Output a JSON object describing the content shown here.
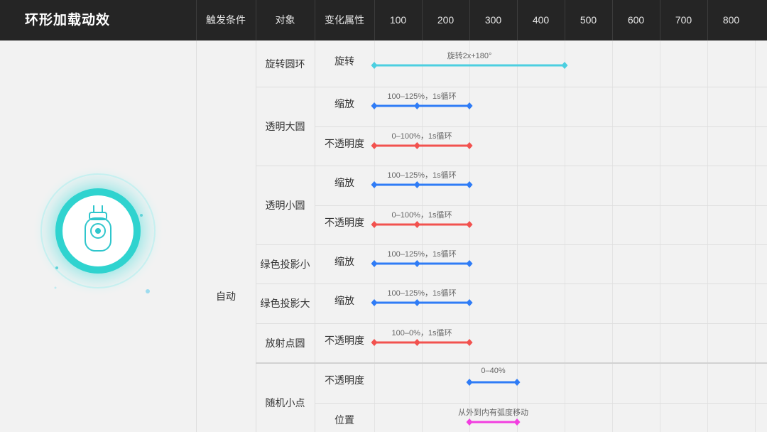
{
  "header": {
    "title": "环形加载动效",
    "columns": [
      "触发条件",
      "对象",
      "变化属性"
    ],
    "ticks": [
      "100",
      "200",
      "300",
      "400",
      "500",
      "600",
      "700",
      "800"
    ]
  },
  "trigger": "自动",
  "colors": {
    "cyan": "#4ccfe0",
    "blue": "#2f7cf6",
    "red": "#f2524f",
    "magenta": "#f23ee0",
    "header_bg": "#252525",
    "body_bg": "#f2f2f2"
  },
  "groups": [
    {
      "object": "旋转圆环",
      "props": [
        "旋转"
      ]
    },
    {
      "object": "透明大圆",
      "props": [
        "缩放",
        "不透明度"
      ]
    },
    {
      "object": "透明小圆",
      "props": [
        "缩放",
        "不透明度"
      ]
    },
    {
      "object": "绿色投影小",
      "props": [
        "缩放"
      ]
    },
    {
      "object": "绿色投影大",
      "props": [
        "缩放"
      ]
    },
    {
      "object": "放射点圆",
      "props": [
        "不透明度"
      ]
    },
    {
      "object": "随机小点",
      "props": [
        "不透明度",
        "位置"
      ]
    }
  ],
  "chart_data": {
    "type": "timeline",
    "x_axis": [
      100,
      200,
      300,
      400,
      500,
      600,
      700,
      800
    ],
    "tracks": [
      {
        "object": "旋转圆环",
        "property": "旋转",
        "label": "旋转2x+180°",
        "start": 0,
        "end": 400,
        "keyframes": [
          0,
          400
        ],
        "color": "cyan"
      },
      {
        "object": "透明大圆",
        "property": "缩放",
        "label": "100–125%，1s循环",
        "start": 0,
        "end": 200,
        "keyframes": [
          0,
          90,
          200
        ],
        "color": "blue"
      },
      {
        "object": "透明大圆",
        "property": "不透明度",
        "label": "0–100%，1s循环",
        "start": 0,
        "end": 200,
        "keyframes": [
          0,
          90,
          200
        ],
        "color": "red"
      },
      {
        "object": "透明小圆",
        "property": "缩放",
        "label": "100–125%，1s循环",
        "start": 0,
        "end": 200,
        "keyframes": [
          0,
          90,
          200
        ],
        "color": "blue"
      },
      {
        "object": "透明小圆",
        "property": "不透明度",
        "label": "0–100%，1s循环",
        "start": 0,
        "end": 200,
        "keyframes": [
          0,
          90,
          200
        ],
        "color": "red"
      },
      {
        "object": "绿色投影小",
        "property": "缩放",
        "label": "100–125%，1s循环",
        "start": 0,
        "end": 200,
        "keyframes": [
          0,
          90,
          200
        ],
        "color": "blue"
      },
      {
        "object": "绿色投影大",
        "property": "缩放",
        "label": "100–125%，1s循环",
        "start": 0,
        "end": 200,
        "keyframes": [
          0,
          90,
          200
        ],
        "color": "blue"
      },
      {
        "object": "放射点圆",
        "property": "不透明度",
        "label": "100–0%，1s循环",
        "start": 0,
        "end": 200,
        "keyframes": [
          0,
          90,
          200
        ],
        "color": "red"
      },
      {
        "object": "随机小点",
        "property": "不透明度",
        "label": "0–40%",
        "start": 200,
        "end": 300,
        "keyframes": [
          200,
          300
        ],
        "color": "blue"
      },
      {
        "object": "随机小点",
        "property": "位置",
        "label": "从外到内有弧度移动",
        "start": 200,
        "end": 300,
        "keyframes": [
          200,
          300
        ],
        "color": "magenta"
      }
    ]
  }
}
